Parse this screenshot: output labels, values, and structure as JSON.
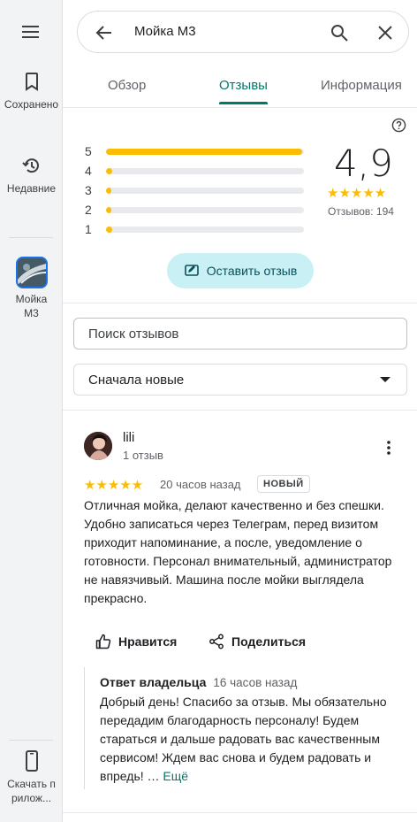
{
  "rail": {
    "items": [
      {
        "label": "Сохранено",
        "icon": "bookmark-icon"
      },
      {
        "label": "Недавние",
        "icon": "history-icon"
      },
      {
        "label": "Мойка М3",
        "icon": "place-thumbnail"
      },
      {
        "label": "Скачать прилож...",
        "icon": "phone-icon"
      }
    ]
  },
  "search": {
    "query": "Мойка М3"
  },
  "tabs": [
    {
      "label": "Обзор"
    },
    {
      "label": "Отзывы",
      "active": true
    },
    {
      "label": "Информация"
    }
  ],
  "rating": {
    "score": "4,9",
    "stars": "★★★★★",
    "count_text": "Отзывов: 194",
    "distribution": [
      {
        "star": "5",
        "fraction": 0.99
      },
      {
        "star": "4",
        "fraction": 0.03
      },
      {
        "star": "3",
        "fraction": 0.01
      },
      {
        "star": "2",
        "fraction": 0.01
      },
      {
        "star": "1",
        "fraction": 0.03
      }
    ],
    "accent_color": "#fbbc04"
  },
  "write_review_label": "Оставить отзыв",
  "review_search_placeholder": "Поиск отзывов",
  "sort": {
    "selected": "Сначала новые"
  },
  "review": {
    "author": "lili",
    "author_sub": "1 отзыв",
    "stars": "★★★★★",
    "time": "20 часов назад",
    "badge": "НОВЫЙ",
    "text": "Отличная мойка, делают качественно и без спешки. Удобно записаться через Телеграм, перед визитом приходит напоминание, а после, уведомление о готовности. Персонал внимательный, администратор не навязчивый. Машина после мойки выглядела прекрасно.",
    "like_label": "Нравится",
    "share_label": "Поделиться",
    "owner_reply": {
      "title": "Ответ владельца",
      "time": "16 часов назад",
      "text": "Добрый день! Спасибо за отзыв. Мы обязательно передадим благодарность персоналу! Будем стараться и дальше радовать вас качественным сервисом! Ждем вас снова и будем радовать и впредь! …",
      "more_label": "Ещё"
    }
  },
  "colors": {
    "accent": "#00796b",
    "chip_bg": "#c9f1f5"
  }
}
